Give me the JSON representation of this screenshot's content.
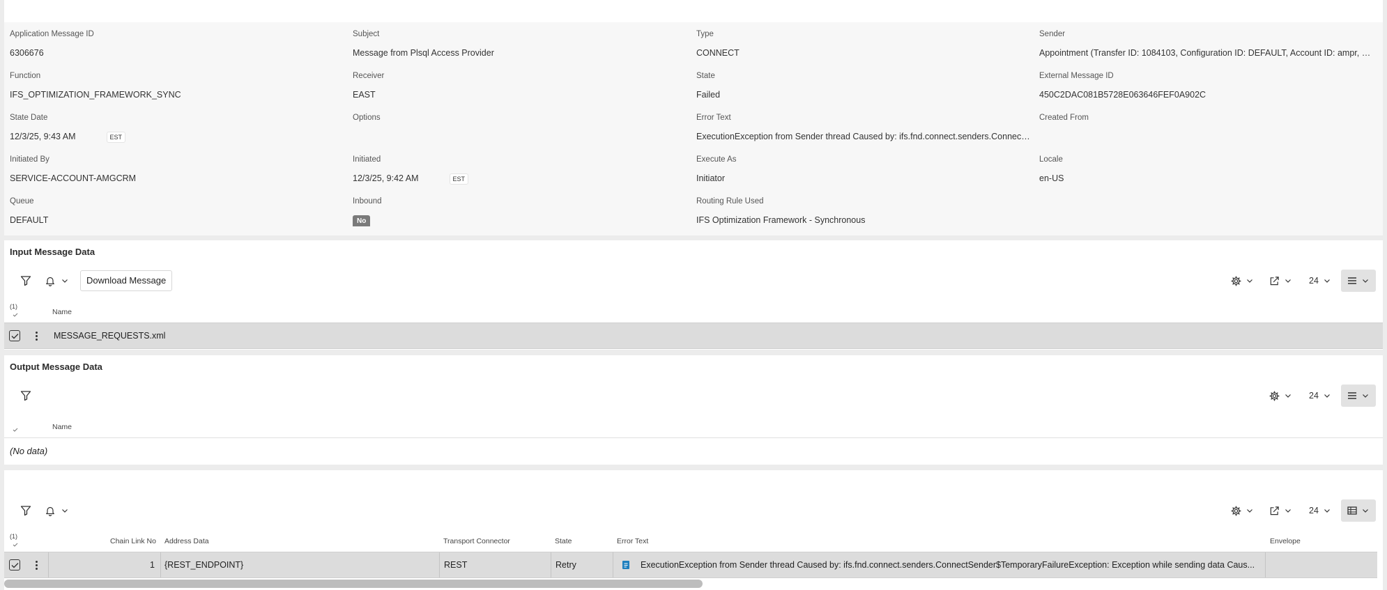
{
  "header": {
    "fields": [
      {
        "label": "Application Message ID",
        "value": "6306676"
      },
      {
        "label": "Subject",
        "value": "Message from Plsql Access Provider"
      },
      {
        "label": "Type",
        "value": "CONNECT"
      },
      {
        "label": "Sender",
        "value": "Appointment (Transfer ID: 1084103, Configuration ID: DEFAULT, Account ID: ampr, Sl..."
      },
      {
        "label": "Function",
        "value": "IFS_OPTIMIZATION_FRAMEWORK_SYNC"
      },
      {
        "label": "Receiver",
        "value": "EAST"
      },
      {
        "label": "State",
        "value": "Failed"
      },
      {
        "label": "External Message ID",
        "value": "450C2DAC081B5728E063646FEF0A902C"
      },
      {
        "label": "State Date",
        "value": "12/3/25, 9:43 AM",
        "tz": "EST"
      },
      {
        "label": "Options",
        "value": ""
      },
      {
        "label": "Error Text",
        "value": "ExecutionException from Sender thread Caused by: ifs.fnd.connect.senders.Connect..."
      },
      {
        "label": "Created From",
        "value": ""
      },
      {
        "label": "Initiated By",
        "value": "SERVICE-ACCOUNT-AMGCRM"
      },
      {
        "label": "Initiated",
        "value": "12/3/25, 9:42 AM",
        "tz": "EST"
      },
      {
        "label": "Execute As",
        "value": "Initiator"
      },
      {
        "label": "Locale",
        "value": "en-US"
      },
      {
        "label": "Queue",
        "value": "DEFAULT"
      },
      {
        "label": "Inbound",
        "value": "No"
      },
      {
        "label": "Routing Rule Used",
        "value": "IFS Optimization Framework - Synchronous"
      }
    ]
  },
  "input_section": {
    "title": "Input Message Data",
    "download_label": "Download Message",
    "page_size": "24",
    "selected_count": "(1)",
    "col_name": "Name",
    "rows": [
      {
        "name": "MESSAGE_REQUESTS.xml"
      }
    ]
  },
  "output_section": {
    "title": "Output Message Data",
    "page_size": "24",
    "col_name": "Name",
    "empty_text": "(No data)"
  },
  "chain_section": {
    "page_size": "24",
    "selected_count": "(1)",
    "columns": {
      "chain_link_no": "Chain Link No",
      "address_data": "Address Data",
      "transport_connector": "Transport Connector",
      "state": "State",
      "error_text": "Error Text",
      "envelope": "Envelope"
    },
    "rows": [
      {
        "chain_link_no": "1",
        "address_data": "{REST_ENDPOINT}",
        "transport_connector": "REST",
        "state": "Retry",
        "error_text": "ExecutionException from Sender thread  Caused by: ifs.fnd.connect.senders.ConnectSender$TemporaryFailureException: Exception while sending data  Caus..."
      }
    ]
  },
  "colors": {
    "link": "#1e7fbe",
    "row_selected": "#dcdcdc",
    "badge": "#7a7a7a"
  }
}
